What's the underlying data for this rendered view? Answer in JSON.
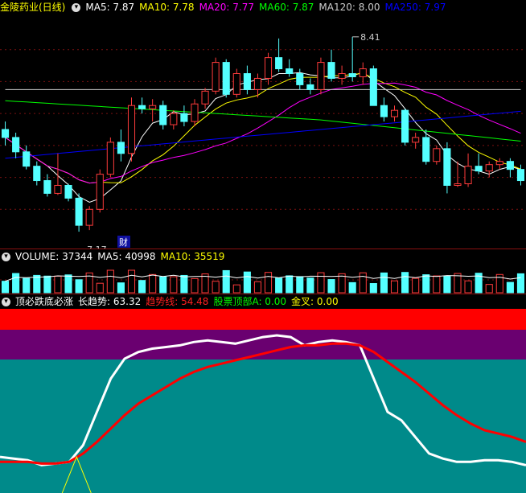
{
  "price_panel": {
    "title": "金陵药业(日线)",
    "ma_labels": [
      {
        "name": "MA5",
        "value": "7.87",
        "color": "#ffffff"
      },
      {
        "name": "MA10",
        "value": "7.78",
        "color": "#ffff00"
      },
      {
        "name": "MA20",
        "value": "7.77",
        "color": "#ff00ff"
      },
      {
        "name": "MA60",
        "value": "7.87",
        "color": "#00ff00"
      },
      {
        "name": "MA120",
        "value": "8.00",
        "color": "#cccccc"
      },
      {
        "name": "MA250",
        "value": "7.97",
        "color": "#0000ff"
      }
    ],
    "high_marker": "8.41",
    "low_marker": "7.17",
    "badge": "财"
  },
  "volume_panel": {
    "labels": [
      {
        "name": "VOLUME",
        "value": "37344",
        "color": "#ffffff"
      },
      {
        "name": "MA5",
        "value": "40998",
        "color": "#ffffff"
      },
      {
        "name": "MA10",
        "value": "35519",
        "color": "#ffff00"
      }
    ]
  },
  "indicator_panel": {
    "title": "顶必跌底必涨",
    "labels": [
      {
        "name": "长趋势",
        "value": "63.32",
        "color": "#ffffff"
      },
      {
        "name": "趋势线",
        "value": "54.48",
        "color": "#ff2020"
      },
      {
        "name": "股票顶部A",
        "value": "0.00",
        "color": "#00ff00"
      },
      {
        "name": "金叉",
        "value": "0.00",
        "color": "#ffff00"
      }
    ]
  },
  "chart_data": {
    "type": "candlestick",
    "ylim": [
      7.1,
      8.5
    ],
    "candles": [
      [
        7.8,
        7.85,
        7.7,
        7.75
      ],
      [
        7.75,
        7.78,
        7.62,
        7.66
      ],
      [
        7.66,
        7.7,
        7.55,
        7.57
      ],
      [
        7.57,
        7.6,
        7.45,
        7.48
      ],
      [
        7.48,
        7.52,
        7.38,
        7.4
      ],
      [
        7.4,
        7.65,
        7.39,
        7.45
      ],
      [
        7.45,
        7.46,
        7.35,
        7.37
      ],
      [
        7.37,
        7.4,
        7.16,
        7.2
      ],
      [
        7.2,
        7.32,
        7.17,
        7.3
      ],
      [
        7.3,
        7.55,
        7.28,
        7.52
      ],
      [
        7.52,
        7.75,
        7.5,
        7.72
      ],
      [
        7.72,
        7.8,
        7.6,
        7.65
      ],
      [
        7.65,
        8.0,
        7.6,
        7.95
      ],
      [
        7.95,
        8.0,
        7.9,
        7.93
      ],
      [
        7.93,
        7.99,
        7.85,
        7.95
      ],
      [
        7.95,
        7.98,
        7.8,
        7.83
      ],
      [
        7.83,
        7.92,
        7.8,
        7.9
      ],
      [
        7.9,
        7.95,
        7.82,
        7.85
      ],
      [
        7.85,
        7.99,
        7.82,
        7.96
      ],
      [
        7.96,
        8.06,
        7.93,
        8.04
      ],
      [
        8.04,
        8.25,
        8.02,
        8.22
      ],
      [
        8.22,
        8.24,
        8.0,
        8.02
      ],
      [
        8.02,
        8.18,
        8.0,
        8.15
      ],
      [
        8.15,
        8.2,
        8.02,
        8.05
      ],
      [
        8.05,
        8.15,
        8.0,
        8.12
      ],
      [
        8.12,
        8.28,
        8.08,
        8.25
      ],
      [
        8.25,
        8.37,
        8.16,
        8.18
      ],
      [
        8.18,
        8.24,
        8.13,
        8.15
      ],
      [
        8.15,
        8.18,
        8.05,
        8.08
      ],
      [
        8.08,
        8.12,
        8.02,
        8.05
      ],
      [
        8.05,
        8.25,
        8.02,
        8.22
      ],
      [
        8.22,
        8.3,
        8.1,
        8.12
      ],
      [
        8.12,
        8.2,
        8.08,
        8.15
      ],
      [
        8.15,
        8.38,
        8.1,
        8.13
      ],
      [
        8.13,
        8.22,
        8.08,
        8.18
      ],
      [
        8.18,
        8.2,
        8.05,
        7.95
      ],
      [
        7.95,
        8.0,
        7.85,
        7.88
      ],
      [
        7.88,
        7.95,
        7.85,
        7.92
      ],
      [
        7.92,
        7.93,
        7.7,
        7.72
      ],
      [
        7.72,
        7.78,
        7.68,
        7.75
      ],
      [
        7.75,
        7.8,
        7.58,
        7.6
      ],
      [
        7.6,
        7.7,
        7.58,
        7.68
      ],
      [
        7.68,
        7.72,
        7.4,
        7.45
      ],
      [
        7.45,
        7.6,
        7.44,
        7.46
      ],
      [
        7.46,
        7.65,
        7.44,
        7.57
      ],
      [
        7.57,
        7.65,
        7.52,
        7.54
      ],
      [
        7.54,
        7.6,
        7.5,
        7.58
      ],
      [
        7.58,
        7.62,
        7.55,
        7.6
      ],
      [
        7.6,
        7.62,
        7.5,
        7.55
      ],
      [
        7.55,
        7.58,
        7.45,
        7.48
      ]
    ],
    "indicator_lines": {
      "长趋势": [
        13,
        12,
        11,
        8,
        9,
        10,
        20,
        40,
        60,
        72,
        76,
        78,
        79,
        80,
        82,
        83,
        82,
        81,
        83,
        85,
        86,
        85,
        80,
        82,
        83,
        82,
        80,
        60,
        40,
        35,
        25,
        15,
        12,
        10,
        10,
        11,
        11,
        10,
        8
      ],
      "趋势线": [
        10,
        10,
        10,
        9,
        9,
        10,
        15,
        22,
        30,
        38,
        45,
        50,
        55,
        60,
        64,
        67,
        69,
        71,
        73,
        75,
        77,
        79,
        80,
        80,
        81,
        81,
        80,
        76,
        70,
        64,
        58,
        51,
        44,
        38,
        33,
        29,
        27,
        25,
        22
      ]
    }
  }
}
